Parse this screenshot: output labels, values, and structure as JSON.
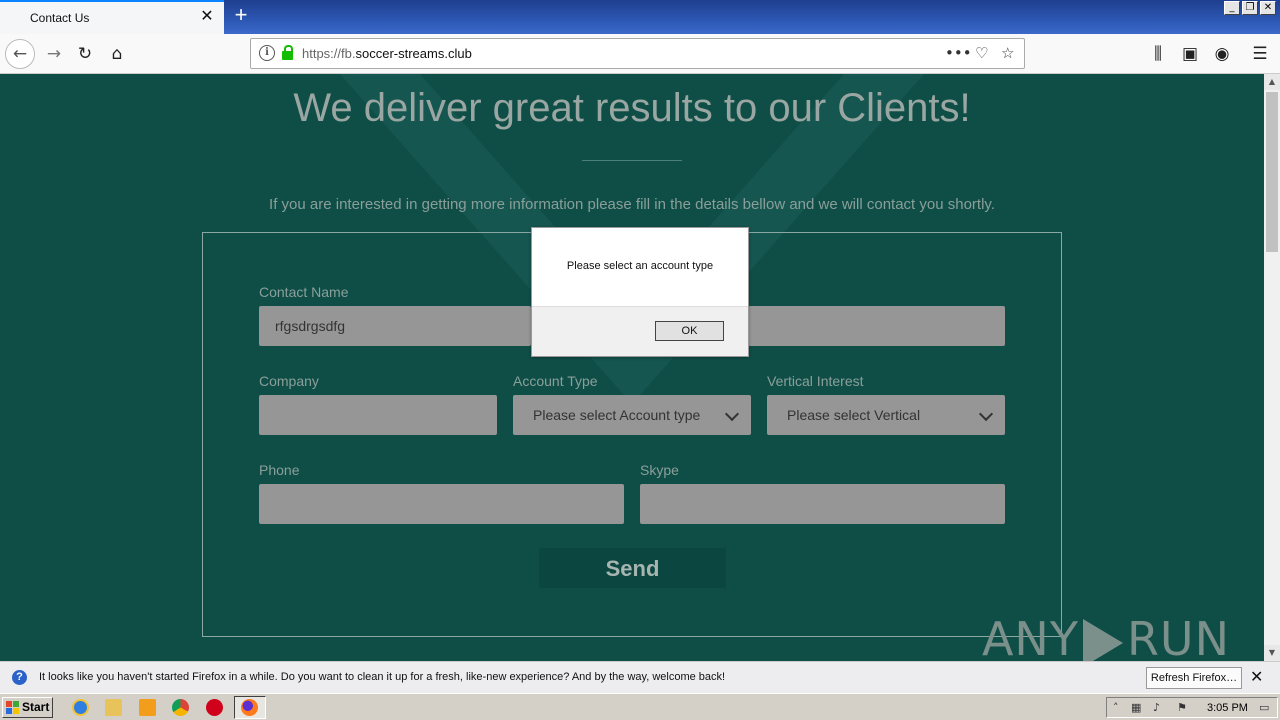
{
  "browser": {
    "tab_title": "Contact Us",
    "tab_close": "✕",
    "new_tab": "+",
    "url_prefix": "https://fb.",
    "url_domain": "soccer-streams.club",
    "window_min": "_",
    "window_restore": "❐",
    "window_close": "✕"
  },
  "page": {
    "headline": "We deliver great results to our Clients!",
    "subtext": "If you are interested in getting more information please fill in the details bellow and we will contact you shortly.",
    "form": {
      "contact_name_label": "Contact Name",
      "contact_name_value": "rfgsdrgsdfg",
      "company_label": "Company",
      "account_type_label": "Account Type",
      "account_type_value": "Please select Account type",
      "vertical_label": "Vertical Interest",
      "vertical_value": "Please select Vertical",
      "phone_label": "Phone",
      "skype_label": "Skype",
      "send_label": "Send"
    },
    "watermark_left": "ANY",
    "watermark_right": "RUN"
  },
  "dialog": {
    "message": "Please select an account type",
    "ok_label": "OK"
  },
  "notification": {
    "icon": "?",
    "text": "It looks like you haven't started Firefox in a while. Do you want to clean it up for a fresh, like-new experience? And by the way, welcome back!",
    "button_label": "Refresh Firefox…",
    "close": "✕"
  },
  "taskbar": {
    "start_label": "Start",
    "clock": "3:05 PM"
  }
}
